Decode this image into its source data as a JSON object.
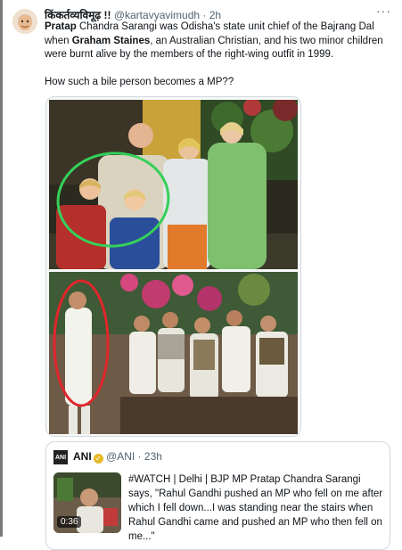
{
  "tweet": {
    "author_name": "किंकर्तव्यविमूढ़ !!",
    "handle": "@kartavyavimudh",
    "separator": "·",
    "time": "2h",
    "more_label": "···",
    "text": {
      "name1": "Pratap",
      "seg1": " Chandra Sarangi was Odisha's state unit chief of the Bajrang Dal when ",
      "name2": "Graham Staines",
      "seg2": ", an Australian Christian, and his two minor children were burnt alive by the members of the right-wing outfit in 1999.",
      "question": "How such a bile person becomes a MP??"
    }
  },
  "quote": {
    "logo_text": "ANI",
    "author_name": "ANI",
    "verified_mark": "✓",
    "handle": "@ANI",
    "separator": "·",
    "time": "23h",
    "video_duration": "0:36",
    "text": "#WATCH | Delhi | BJP MP Pratap Chandra Sarangi says, \"Rahul Gandhi pushed an MP who fell on me after which I fell down...I was standing near the stairs when Rahul Gandhi came and pushed an MP who then fell on me...\""
  },
  "colors": {
    "text_primary": "#0f1419",
    "text_secondary": "#536471",
    "border": "#cfd9de",
    "circle_green": "#35d05a",
    "circle_red": "#e0262b"
  }
}
